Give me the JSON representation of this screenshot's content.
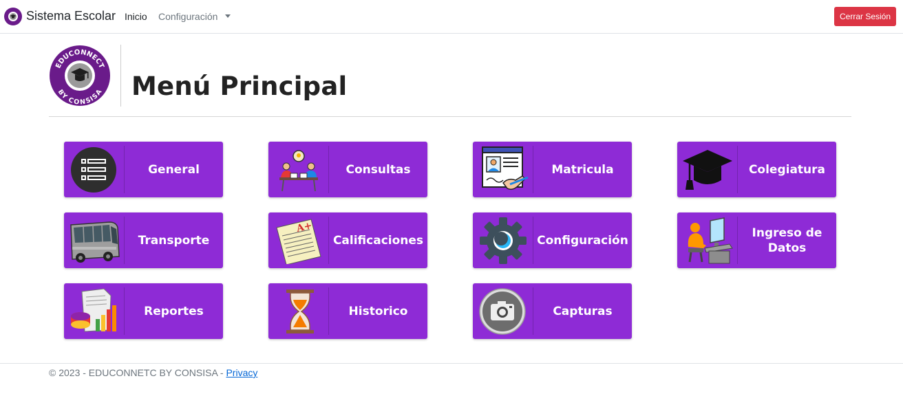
{
  "navbar": {
    "brand": "Sistema Escolar",
    "links": [
      {
        "label": "Inicio"
      },
      {
        "label": "Configuración"
      }
    ],
    "logout_label": "Cerrar Sesión"
  },
  "header": {
    "title": "Menú Principal",
    "logo_icon": "educonnect-logo",
    "logo_text_top": "EDUCONNECT",
    "logo_text_bottom": "BY CONSISA"
  },
  "tiles": [
    {
      "label": "General",
      "icon": "list-icon"
    },
    {
      "label": "Consultas",
      "icon": "meeting-icon"
    },
    {
      "label": "Matricula",
      "icon": "registration-form-icon"
    },
    {
      "label": "Colegiatura",
      "icon": "graduation-cap-icon"
    },
    {
      "label": "Transporte",
      "icon": "bus-icon"
    },
    {
      "label": "Calificaciones",
      "icon": "graded-paper-icon"
    },
    {
      "label": "Configuración",
      "icon": "gear-icon"
    },
    {
      "label": "Ingreso de Datos",
      "icon": "data-entry-icon"
    },
    {
      "label": "Reportes",
      "icon": "report-chart-icon"
    },
    {
      "label": "Historico",
      "icon": "hourglass-icon"
    },
    {
      "label": "Capturas",
      "icon": "camera-icon"
    }
  ],
  "footer": {
    "copyright": "© 2023 - EDUCONNETC BY CONSISA - ",
    "privacy_label": "Privacy"
  },
  "colors": {
    "tile": "#8e2bd6",
    "logout": "#dc3545",
    "logo": "#6a1b8a"
  }
}
